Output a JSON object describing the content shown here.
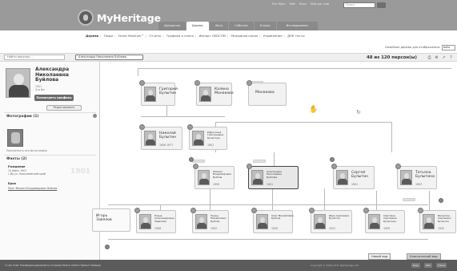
{
  "header": {
    "logo_text": "MyHeritage",
    "top_links": [
      "Пит Бёрн",
      "Мой",
      "Язык",
      "Мой шаг мой"
    ],
    "search_placeholder": "Поиск",
    "tabs": [
      "Домашняя",
      "Дерево",
      "Фото",
      "События",
      "Уголок",
      "Исследование"
    ],
    "active_tab": "Дерево"
  },
  "subnav": {
    "items": [
      "Дерево",
      "Люди",
      "Smart Matches™",
      "Отчеты",
      "Графики и книги",
      "Импорт GEDCOM",
      "Резервная копия",
      "Управление",
      "ДНК тесты"
    ],
    "current": "Дерево"
  },
  "home_family": {
    "label": "Семейное дерево для отображения:",
    "value": "bollo"
  },
  "toolbar": {
    "find_placeholder": "Найти персону...",
    "breadcrumb": "Александра Николаевна Буйлова",
    "people_count": "48 из 120 персон(ы)",
    "icons": [
      "print-icon",
      "settings-icon",
      "share-icon",
      "help-icon"
    ]
  },
  "profile": {
    "name_lines": [
      "Александра",
      "Николаевна",
      "Буйлова"
    ],
    "dates": [
      "1901",
      "Это Вы"
    ],
    "view_button": "Посмотреть профиль",
    "edit_button": "Редактировать",
    "photos_heading": "Фотографии (1)",
    "photo_caption": "Просмотреть все фотографии",
    "facts_heading": "Факты (2)",
    "birth_label": "Рождение",
    "birth_value": [
      "14 Июнь 1901",
      "г.Ио ул. Николаевский край"
    ],
    "birth_year_big": "1901",
    "spouse_label": "Брак",
    "spouse_value": "Муж: Михаил Владимирович Вейнов"
  },
  "tree": {
    "cards": [
      {
        "id": "grigoriy",
        "lines": [
          "Григорий",
          "Булытин"
        ],
        "dates": ""
      },
      {
        "id": "kalina",
        "lines": [
          "Калина",
          "Монакова"
        ],
        "dates": ""
      },
      {
        "id": "monakova",
        "lines": [
          "Монакова"
        ],
        "dates": ""
      },
      {
        "id": "nikolai",
        "lines": [
          "Николай",
          "Булытин"
        ],
        "dates": "1856  1977"
      },
      {
        "id": "efrosinia",
        "lines": [
          "Ефросинья",
          "Григорьевна",
          "Булытина"
        ],
        "dates": "1901"
      },
      {
        "id": "mikhail",
        "lines": [
          "Михаил",
          "Владимирович",
          "Буйлов"
        ],
        "dates": "1950"
      },
      {
        "id": "aleksandra",
        "lines": [
          "Александра",
          "Николаевна",
          "Буйлова"
        ],
        "dates": "1901"
      },
      {
        "id": "sergei",
        "lines": [
          "Сергей",
          "Булытин"
        ],
        "dates": "1901"
      },
      {
        "id": "tatiana",
        "lines": [
          "Татьяна",
          "Булытина"
        ],
        "dates": "1903"
      },
      {
        "id": "igor",
        "lines": [
          "Игорь",
          "Завялов"
        ],
        "dates": ""
      },
      {
        "id": "elena",
        "lines": [
          "Елена",
          "Александровна",
          "Завялова"
        ],
        "dates": "1908"
      },
      {
        "id": "roman",
        "lines": [
          "Роман",
          "Михайлович",
          "Буйлов"
        ],
        "dates": "1952"
      },
      {
        "id": "oleg",
        "lines": [
          "Олег Михайлович",
          "Буйлов"
        ],
        "dates": "1930"
      },
      {
        "id": "ivan",
        "lines": [
          "Иван Сергеевич",
          "Булытин"
        ],
        "dates": "1931"
      },
      {
        "id": "svetlana",
        "lines": [
          "Светлана",
          "Сергеевна",
          "Булытина"
        ],
        "dates": "1929"
      },
      {
        "id": "valentin",
        "lines": [
          "Валентин",
          "Сергеевич",
          "Булытин"
        ],
        "dates": "1932"
      }
    ]
  },
  "view_buttons": [
    "Новый вид",
    "Классический вид"
  ],
  "footer": {
    "links": "О нас   Блог   Конфиденциальность   Условия   Карта сайта   Пресса   Помощь",
    "copyright": "Copyright © 2006-2011 MyHeritage Ltd.",
    "badges": [
      "Ещё",
      "RSS",
      "Follow"
    ]
  }
}
